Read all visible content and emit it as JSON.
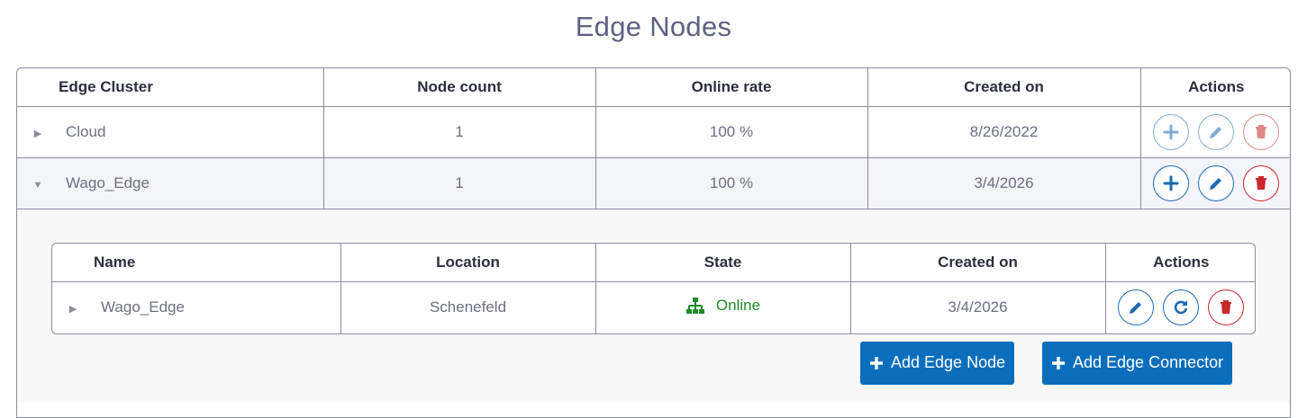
{
  "page": {
    "title": "Edge Nodes"
  },
  "clusters_table": {
    "headers": [
      "Edge Cluster",
      "Node count",
      "Online rate",
      "Created on",
      "Actions"
    ],
    "rows": [
      {
        "name": "Cloud",
        "node_count": "1",
        "online_rate": "100 %",
        "created_on": "8/26/2022",
        "expanded": false
      },
      {
        "name": "Wago_Edge",
        "node_count": "1",
        "online_rate": "100 %",
        "created_on": "3/4/2026",
        "expanded": true
      }
    ]
  },
  "nodes_table": {
    "headers": [
      "Name",
      "Location",
      "State",
      "Created on",
      "Actions"
    ],
    "rows": [
      {
        "name": "Wago_Edge",
        "location": "Schenefeld",
        "state": "Online",
        "created_on": "3/4/2026"
      }
    ]
  },
  "buttons": {
    "add_edge_node": "Add Edge Node",
    "add_edge_connector": "Add Edge Connector"
  },
  "colors": {
    "primary": "#0a6ebd",
    "action_blue": "#1a68b3",
    "delete_red": "#c9282d",
    "online_green": "#1f8a2a"
  },
  "icons": [
    "caret-right-icon",
    "caret-down-icon",
    "plus-icon",
    "pencil-icon",
    "trash-icon",
    "refresh-icon",
    "network-icon"
  ]
}
